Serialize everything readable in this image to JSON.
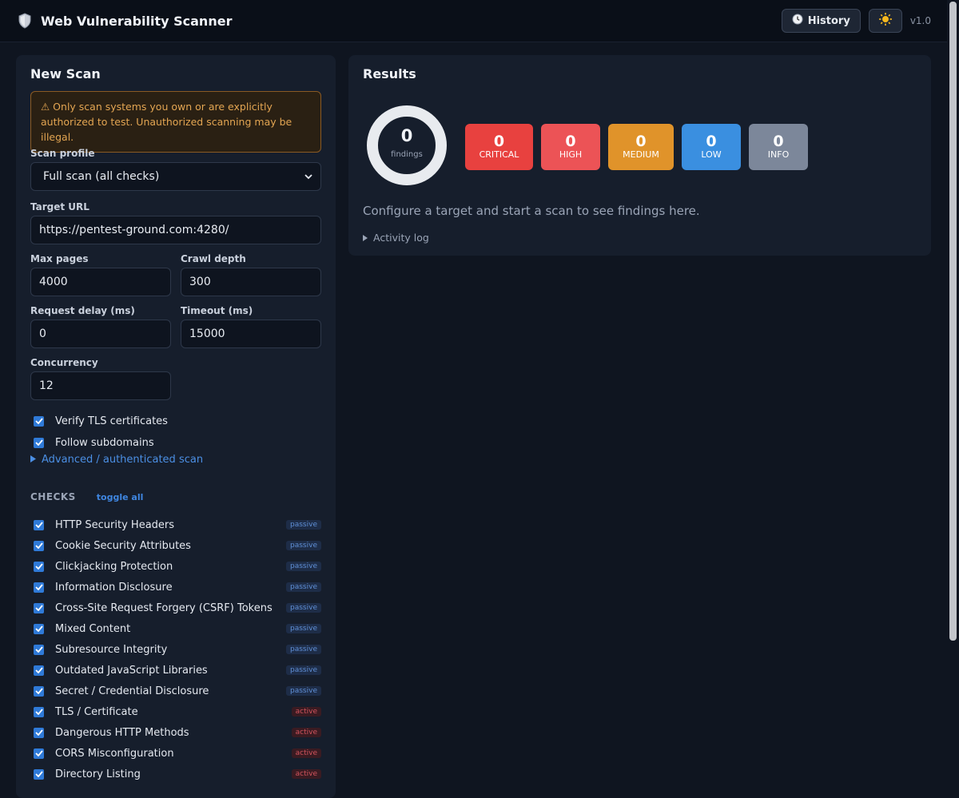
{
  "app": {
    "title": "Web Vulnerability Scanner",
    "icon": "shield-icon",
    "version": "v1.0"
  },
  "toolbar": {
    "history_label": "History",
    "history_icon": "clock-icon",
    "theme_icon": "sun-icon"
  },
  "scan": {
    "title": "New Scan",
    "warning": "⚠ Only scan systems you own or are explicitly authorized to test. Unauthorized scanning may be illegal.",
    "profile_label": "Scan profile",
    "profile_value": "Full scan (all checks)",
    "url_label": "Target URL",
    "url_value": "https://pentest-ground.com:4280/",
    "max_pages_label": "Max pages",
    "max_pages_value": "4000",
    "crawl_depth_label": "Crawl depth",
    "crawl_depth_value": "300",
    "request_delay_label": "Request delay (ms)",
    "request_delay_value": "0",
    "timeout_label": "Timeout (ms)",
    "timeout_value": "15000",
    "concurrency_label": "Concurrency",
    "concurrency_value": "12",
    "verify_tls_label": "Verify TLS certificates",
    "follow_subdomains_label": "Follow subdomains",
    "advanced_label": "Advanced / authenticated scan"
  },
  "checks": {
    "title": "CHECKS",
    "toggle_all": "toggle all",
    "items": [
      {
        "label": "HTTP Security Headers",
        "type": "passive"
      },
      {
        "label": "Cookie Security Attributes",
        "type": "passive"
      },
      {
        "label": "Clickjacking Protection",
        "type": "passive"
      },
      {
        "label": "Information Disclosure",
        "type": "passive"
      },
      {
        "label": "Cross-Site Request Forgery (CSRF) Tokens",
        "type": "passive"
      },
      {
        "label": "Mixed Content",
        "type": "passive"
      },
      {
        "label": "Subresource Integrity",
        "type": "passive"
      },
      {
        "label": "Outdated JavaScript Libraries",
        "type": "passive"
      },
      {
        "label": "Secret / Credential Disclosure",
        "type": "passive"
      },
      {
        "label": "TLS / Certificate",
        "type": "active"
      },
      {
        "label": "Dangerous HTTP Methods",
        "type": "active"
      },
      {
        "label": "CORS Misconfiguration",
        "type": "active"
      },
      {
        "label": "Directory Listing",
        "type": "active"
      }
    ]
  },
  "results": {
    "title": "Results",
    "total": "0",
    "total_label": "findings",
    "severities": [
      {
        "count": "0",
        "label": "CRITICAL",
        "color": "#e8413f"
      },
      {
        "count": "0",
        "label": "HIGH",
        "color": "#ec5356"
      },
      {
        "count": "0",
        "label": "MEDIUM",
        "color": "#e0932a"
      },
      {
        "count": "0",
        "label": "LOW",
        "color": "#3a8fe0"
      },
      {
        "count": "0",
        "label": "INFO",
        "color": "#7c879a"
      }
    ],
    "empty_message": "Configure a target and start a scan to see findings here.",
    "activity_log_label": "Activity log"
  },
  "colors": {
    "accent": "#2f7ad8",
    "panel": "#161e2c",
    "background": "#0f1520"
  }
}
